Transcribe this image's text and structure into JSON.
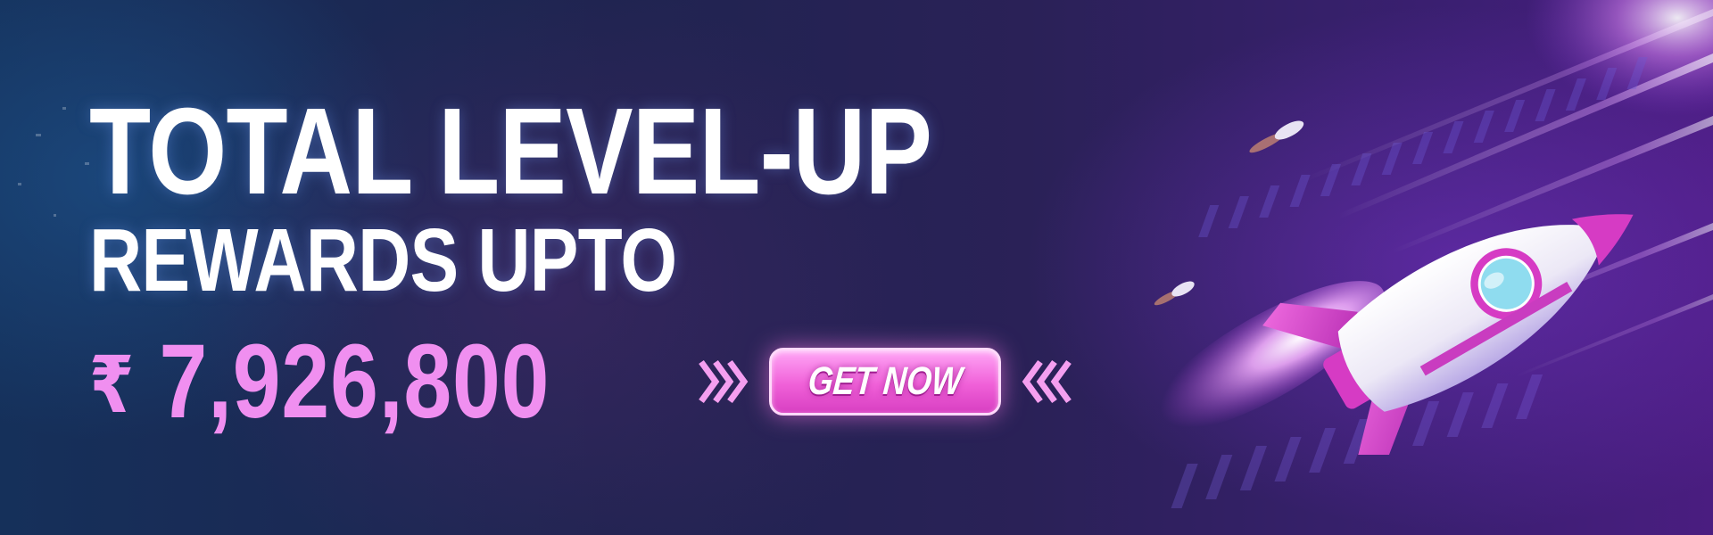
{
  "banner": {
    "headline_line1": "TOTAL LEVEL-UP",
    "headline_line2": "REWARDS UPTO",
    "currency_symbol": "₹",
    "amount": "7,926,800",
    "cta_label": "GET NOW"
  },
  "colors": {
    "headline": "#ffffff",
    "amount": "#f08ff0",
    "cta_fill": "#f060d8",
    "cta_border": "#ffd9fb",
    "chevron": "#f59ff0",
    "rocket_body": "#f3f1fb",
    "rocket_accent": "#d63bc4",
    "rocket_window": "#8fdcef"
  },
  "icons": {
    "left": "chevrons-right-icon",
    "right": "chevrons-left-icon",
    "illustration": "rocket-icon"
  }
}
